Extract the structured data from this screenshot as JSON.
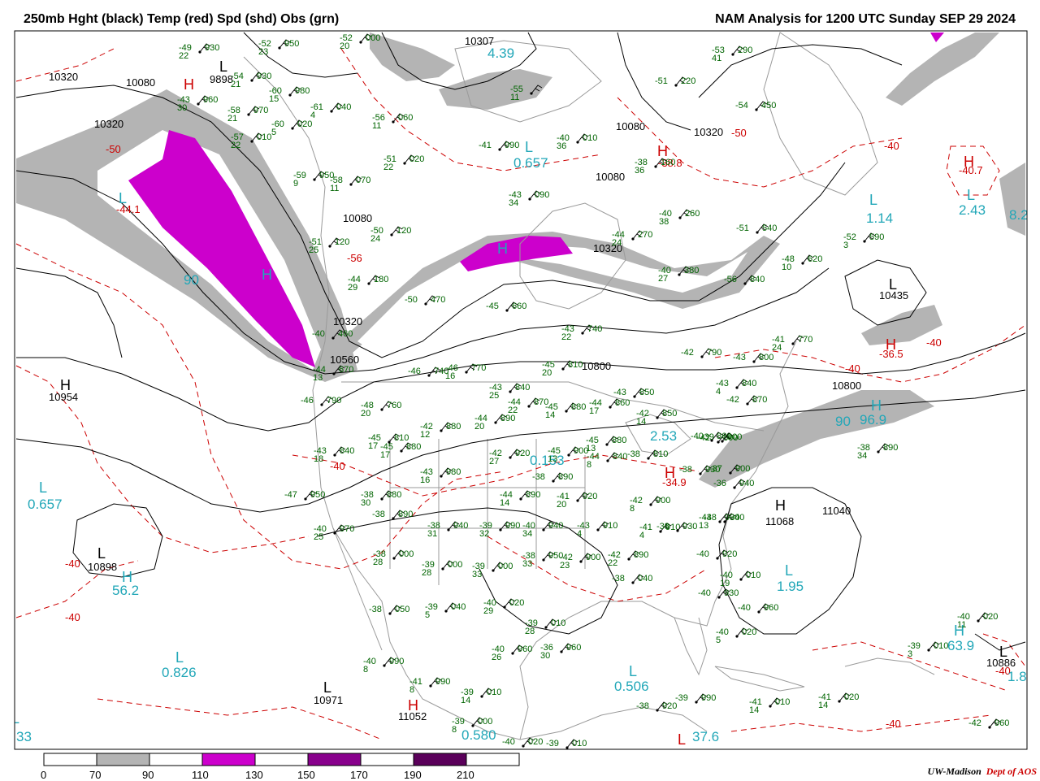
{
  "header": {
    "left_title": "250mb Hght (black) Temp (red) Spd (shd) Obs (grn)",
    "right_title": "NAM Analysis for 1200 UTC Sunday  SEP 29 2024"
  },
  "colors": {
    "height_contour": "#000000",
    "temperature_contour": "#cc0000",
    "speed_70_90": "#b4b4b4",
    "speed_90_110": "#ffffff",
    "speed_110_130": "#cc00cc",
    "speed_130_150": "#9900aa",
    "speed_150_170": "#88008c",
    "speed_170_190": "#ffffff",
    "speed_190_210": "#5a005a",
    "observations": "#006400",
    "extrema_labels": "#22a7b8",
    "boundaries": "#9a9a9a"
  },
  "legend": {
    "ticks": [
      "0",
      "70",
      "90",
      "110",
      "130",
      "150",
      "170",
      "190",
      "210"
    ]
  },
  "credit": {
    "org": "UW-Madison",
    "dept": "Dept of AOS"
  },
  "height_labels": [
    "10320",
    "10080",
    "9898",
    "10320",
    "10307",
    "10080",
    "10320",
    "10080",
    "10080",
    "10320",
    "10320",
    "10560",
    "10954",
    "10800",
    "10800",
    "10435",
    "11068",
    "11040",
    "10898",
    "10971",
    "11052",
    "10886"
  ],
  "extrema": [
    {
      "letter": "H",
      "value": "10954"
    },
    {
      "letter": "L",
      "value": "9898"
    },
    {
      "letter": "H",
      "value": "11068"
    },
    {
      "letter": "L",
      "value": "10898"
    },
    {
      "letter": "L",
      "value": "10971"
    },
    {
      "letter": "H",
      "value": "11052"
    },
    {
      "letter": "L",
      "value": "10435"
    },
    {
      "letter": "L",
      "value": "10886"
    }
  ],
  "cyan_labels": [
    "4.39",
    "0.657",
    "2.43",
    "1.14",
    "0.657",
    "56.2",
    "0.826",
    "2.53",
    "0.153",
    "1.95",
    "0.506",
    "0.580",
    "37.6",
    "63.9",
    "96.9",
    "90",
    "90",
    "1.8",
    "33",
    "8.2"
  ],
  "temp_labels": [
    "-50",
    "-50",
    "-56",
    "-44.1",
    "-40",
    "-40",
    "-36.5",
    "-40",
    "-40",
    "-40",
    "-40",
    "-40.7",
    "-34.9",
    "-38.8",
    "-40",
    "-40"
  ],
  "observations": [
    {
      "t": "-49",
      "h": "930",
      "d": "22"
    },
    {
      "t": "-52",
      "h": "950",
      "d": "23"
    },
    {
      "t": "-52",
      "h": "000",
      "d": "20"
    },
    {
      "t": "-54",
      "h": "930",
      "d": "21"
    },
    {
      "t": "-43",
      "h": "960",
      "d": "30"
    },
    {
      "t": "-58",
      "h": "970",
      "d": "21"
    },
    {
      "t": "-60",
      "h": "980",
      "d": "15"
    },
    {
      "t": "-61",
      "h": "040",
      "d": "4"
    },
    {
      "t": "-60",
      "h": "020",
      "d": "5"
    },
    {
      "t": "-57",
      "h": "010",
      "d": "22"
    },
    {
      "t": "-56",
      "h": "060",
      "d": "11"
    },
    {
      "t": "-55",
      "h": "",
      "d": "11"
    },
    {
      "t": "-51",
      "h": "020",
      "d": "22"
    },
    {
      "t": "-59",
      "h": "950",
      "d": "9"
    },
    {
      "t": "-58",
      "h": "070",
      "d": "11"
    },
    {
      "t": "-41",
      "h": "990",
      "d": ""
    },
    {
      "t": "-40",
      "h": "010",
      "d": "36"
    },
    {
      "t": "-53",
      "h": "290",
      "d": "41"
    },
    {
      "t": "-51",
      "h": "220",
      "d": ""
    },
    {
      "t": "-54",
      "h": "450",
      "d": ""
    },
    {
      "t": "-38",
      "h": "160",
      "d": "36"
    },
    {
      "t": "-43",
      "h": "090",
      "d": "34"
    },
    {
      "t": "-40",
      "h": "260",
      "d": "38"
    },
    {
      "t": "-51",
      "h": "540",
      "d": ""
    },
    {
      "t": "-52",
      "h": "590",
      "d": "3"
    },
    {
      "t": "-48",
      "h": "620",
      "d": "10"
    },
    {
      "t": "-51",
      "h": "120",
      "d": "25"
    },
    {
      "t": "-50",
      "h": "120",
      "d": "24"
    },
    {
      "t": "-44",
      "h": "270",
      "d": "24"
    },
    {
      "t": "-40",
      "h": "380",
      "d": "27"
    },
    {
      "t": "-56",
      "h": "840",
      "d": ""
    },
    {
      "t": "-44",
      "h": "180",
      "d": "29"
    },
    {
      "t": "-50",
      "h": "470",
      "d": ""
    },
    {
      "t": "-45",
      "h": "660",
      "d": ""
    },
    {
      "t": "-43",
      "h": "740",
      "d": "22"
    },
    {
      "t": "-41",
      "h": "770",
      "d": "24"
    },
    {
      "t": "-40",
      "h": "460",
      "d": ""
    },
    {
      "t": "-42",
      "h": "790",
      "d": ""
    },
    {
      "t": "-43",
      "h": "800",
      "d": ""
    },
    {
      "t": "-44",
      "h": "670",
      "d": "13"
    },
    {
      "t": "-46",
      "h": "740",
      "d": ""
    },
    {
      "t": "-46",
      "h": "770",
      "d": "16"
    },
    {
      "t": "-45",
      "h": "810",
      "d": "20"
    },
    {
      "t": "-46",
      "h": "790",
      "d": ""
    },
    {
      "t": "-48",
      "h": "760",
      "d": "20"
    },
    {
      "t": "-43",
      "h": "840",
      "d": "25"
    },
    {
      "t": "-44",
      "h": "870",
      "d": "22"
    },
    {
      "t": "-45",
      "h": "880",
      "d": "14"
    },
    {
      "t": "-44",
      "h": "860",
      "d": "17"
    },
    {
      "t": "-43",
      "h": "850",
      "d": ""
    },
    {
      "t": "-42",
      "h": "850",
      "d": "14"
    },
    {
      "t": "-43",
      "h": "840",
      "d": "4"
    },
    {
      "t": "-42",
      "h": "870",
      "d": ""
    },
    {
      "t": "-42",
      "h": "800",
      "d": ""
    },
    {
      "t": "-45",
      "h": "810",
      "d": "17"
    },
    {
      "t": "-45",
      "h": "880",
      "d": "17"
    },
    {
      "t": "-42",
      "h": "880",
      "d": "12"
    },
    {
      "t": "-44",
      "h": "890",
      "d": "20"
    },
    {
      "t": "-43",
      "h": "840",
      "d": "18"
    },
    {
      "t": "-42",
      "h": "920",
      "d": "27"
    },
    {
      "t": "-45",
      "h": "900",
      "d": "13"
    },
    {
      "t": "-45",
      "h": "880",
      "d": "13"
    },
    {
      "t": "-44",
      "h": "840",
      "d": "8"
    },
    {
      "t": "-38",
      "h": "810",
      "d": ""
    },
    {
      "t": "-40",
      "h": "860",
      "d": ""
    },
    {
      "t": "-39",
      "h": "900",
      "d": ""
    },
    {
      "t": "-38",
      "h": "930",
      "d": ""
    },
    {
      "t": "-37",
      "h": "900",
      "d": ""
    },
    {
      "t": "-36",
      "h": "940",
      "d": ""
    },
    {
      "t": "-38",
      "h": "890",
      "d": "34"
    },
    {
      "t": "-43",
      "h": "980",
      "d": "16"
    },
    {
      "t": "-47",
      "h": "950",
      "d": ""
    },
    {
      "t": "-38",
      "h": "880",
      "d": "30"
    },
    {
      "t": "-38",
      "h": "890",
      "d": ""
    },
    {
      "t": "-44",
      "h": "890",
      "d": "14"
    },
    {
      "t": "-41",
      "h": "920",
      "d": "20"
    },
    {
      "t": "-42",
      "h": "900",
      "d": "8"
    },
    {
      "t": "-38",
      "h": "890",
      "d": ""
    },
    {
      "t": "-40",
      "h": "970",
      "d": "25"
    },
    {
      "t": "-38",
      "h": "940",
      "d": "31"
    },
    {
      "t": "-39",
      "h": "990",
      "d": "32"
    },
    {
      "t": "-40",
      "h": "940",
      "d": "34"
    },
    {
      "t": "-43",
      "h": "910",
      "d": "4"
    },
    {
      "t": "-41",
      "h": "910",
      "d": "4"
    },
    {
      "t": "-38",
      "h": "930",
      "d": ""
    },
    {
      "t": "-38",
      "h": "940",
      "d": ""
    },
    {
      "t": "-38",
      "h": "000",
      "d": "28"
    },
    {
      "t": "-39",
      "h": "000",
      "d": "28"
    },
    {
      "t": "-39",
      "h": "000",
      "d": "33"
    },
    {
      "t": "-38",
      "h": "950",
      "d": "33"
    },
    {
      "t": "-42",
      "h": "900",
      "d": "23"
    },
    {
      "t": "-42",
      "h": "890",
      "d": "22"
    },
    {
      "t": "-40",
      "h": "920",
      "d": ""
    },
    {
      "t": "-40",
      "h": "010",
      "d": "19"
    },
    {
      "t": "-38",
      "h": "040",
      "d": ""
    },
    {
      "t": "-40",
      "h": "930",
      "d": ""
    },
    {
      "t": "-40",
      "h": "960",
      "d": ""
    },
    {
      "t": "-40",
      "h": "020",
      "d": "5"
    },
    {
      "t": "-38",
      "h": "050",
      "d": ""
    },
    {
      "t": "-39",
      "h": "040",
      "d": "5"
    },
    {
      "t": "-40",
      "h": "020",
      "d": "29"
    },
    {
      "t": "-39",
      "h": "010",
      "d": "28"
    },
    {
      "t": "-36",
      "h": "960",
      "d": "30"
    },
    {
      "t": "-40",
      "h": "960",
      "d": "26"
    },
    {
      "t": "-40",
      "h": "990",
      "d": "8"
    },
    {
      "t": "-41",
      "h": "990",
      "d": "8"
    },
    {
      "t": "-39",
      "h": "010",
      "d": "14"
    },
    {
      "t": "-39",
      "h": "000",
      "d": "8"
    },
    {
      "t": "-40",
      "h": "020",
      "d": ""
    },
    {
      "t": "-39",
      "h": "010",
      "d": ""
    },
    {
      "t": "-38",
      "h": "920",
      "d": ""
    },
    {
      "t": "-39",
      "h": "990",
      "d": ""
    },
    {
      "t": "-41",
      "h": "010",
      "d": "14"
    },
    {
      "t": "-41",
      "h": "020",
      "d": "14"
    },
    {
      "t": "-39",
      "h": "010",
      "d": "3"
    },
    {
      "t": "-40",
      "h": "020",
      "d": "11"
    },
    {
      "t": "-42",
      "h": "960",
      "d": ""
    },
    {
      "t": "-44",
      "h": "930",
      "d": "13"
    },
    {
      "t": "-43",
      "h": "930",
      "d": "11"
    },
    {
      "t": "-38",
      "h": "000",
      "d": "28"
    }
  ]
}
